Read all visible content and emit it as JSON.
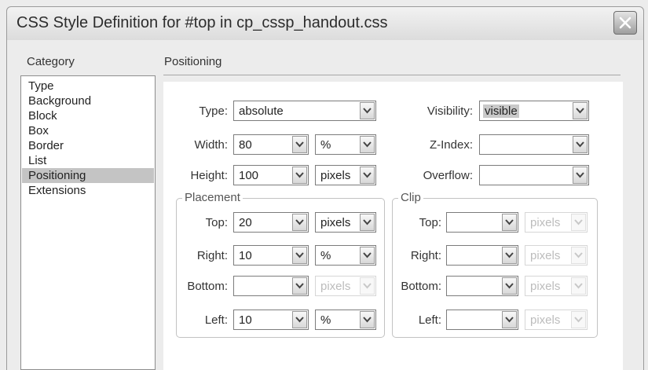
{
  "window": {
    "title": "CSS Style Definition for #top in cp_cssp_handout.css"
  },
  "category": {
    "heading": "Category",
    "items": [
      "Type",
      "Background",
      "Block",
      "Box",
      "Border",
      "List",
      "Positioning",
      "Extensions"
    ],
    "selected": "Positioning"
  },
  "section": {
    "title": "Positioning"
  },
  "fields": {
    "type": {
      "label": "Type:",
      "value": "absolute"
    },
    "width": {
      "label": "Width:",
      "value": "80",
      "unit": "%"
    },
    "height": {
      "label": "Height:",
      "value": "100",
      "unit": "pixels"
    },
    "visibility": {
      "label": "Visibility:",
      "value": "visible"
    },
    "zindex": {
      "label": "Z-Index:",
      "value": ""
    },
    "overflow": {
      "label": "Overflow:",
      "value": ""
    }
  },
  "placement": {
    "legend": "Placement",
    "top": {
      "label": "Top:",
      "value": "20",
      "unit": "pixels"
    },
    "right": {
      "label": "Right:",
      "value": "10",
      "unit": "%"
    },
    "bottom": {
      "label": "Bottom:",
      "value": "",
      "unit": "pixels"
    },
    "left": {
      "label": "Left:",
      "value": "10",
      "unit": "%"
    }
  },
  "clip": {
    "legend": "Clip",
    "top": {
      "label": "Top:",
      "value": "",
      "unit": "pixels"
    },
    "right": {
      "label": "Right:",
      "value": "",
      "unit": "pixels"
    },
    "bottom": {
      "label": "Bottom:",
      "value": "",
      "unit": "pixels"
    },
    "left": {
      "label": "Left:",
      "value": "",
      "unit": "pixels"
    }
  },
  "icons": {
    "close": "close-icon",
    "dropdown": "chevron-down-icon"
  },
  "colors": {
    "selected_item": "#c4c4c4",
    "panel": "#ffffff",
    "dialog": "#ececec"
  }
}
